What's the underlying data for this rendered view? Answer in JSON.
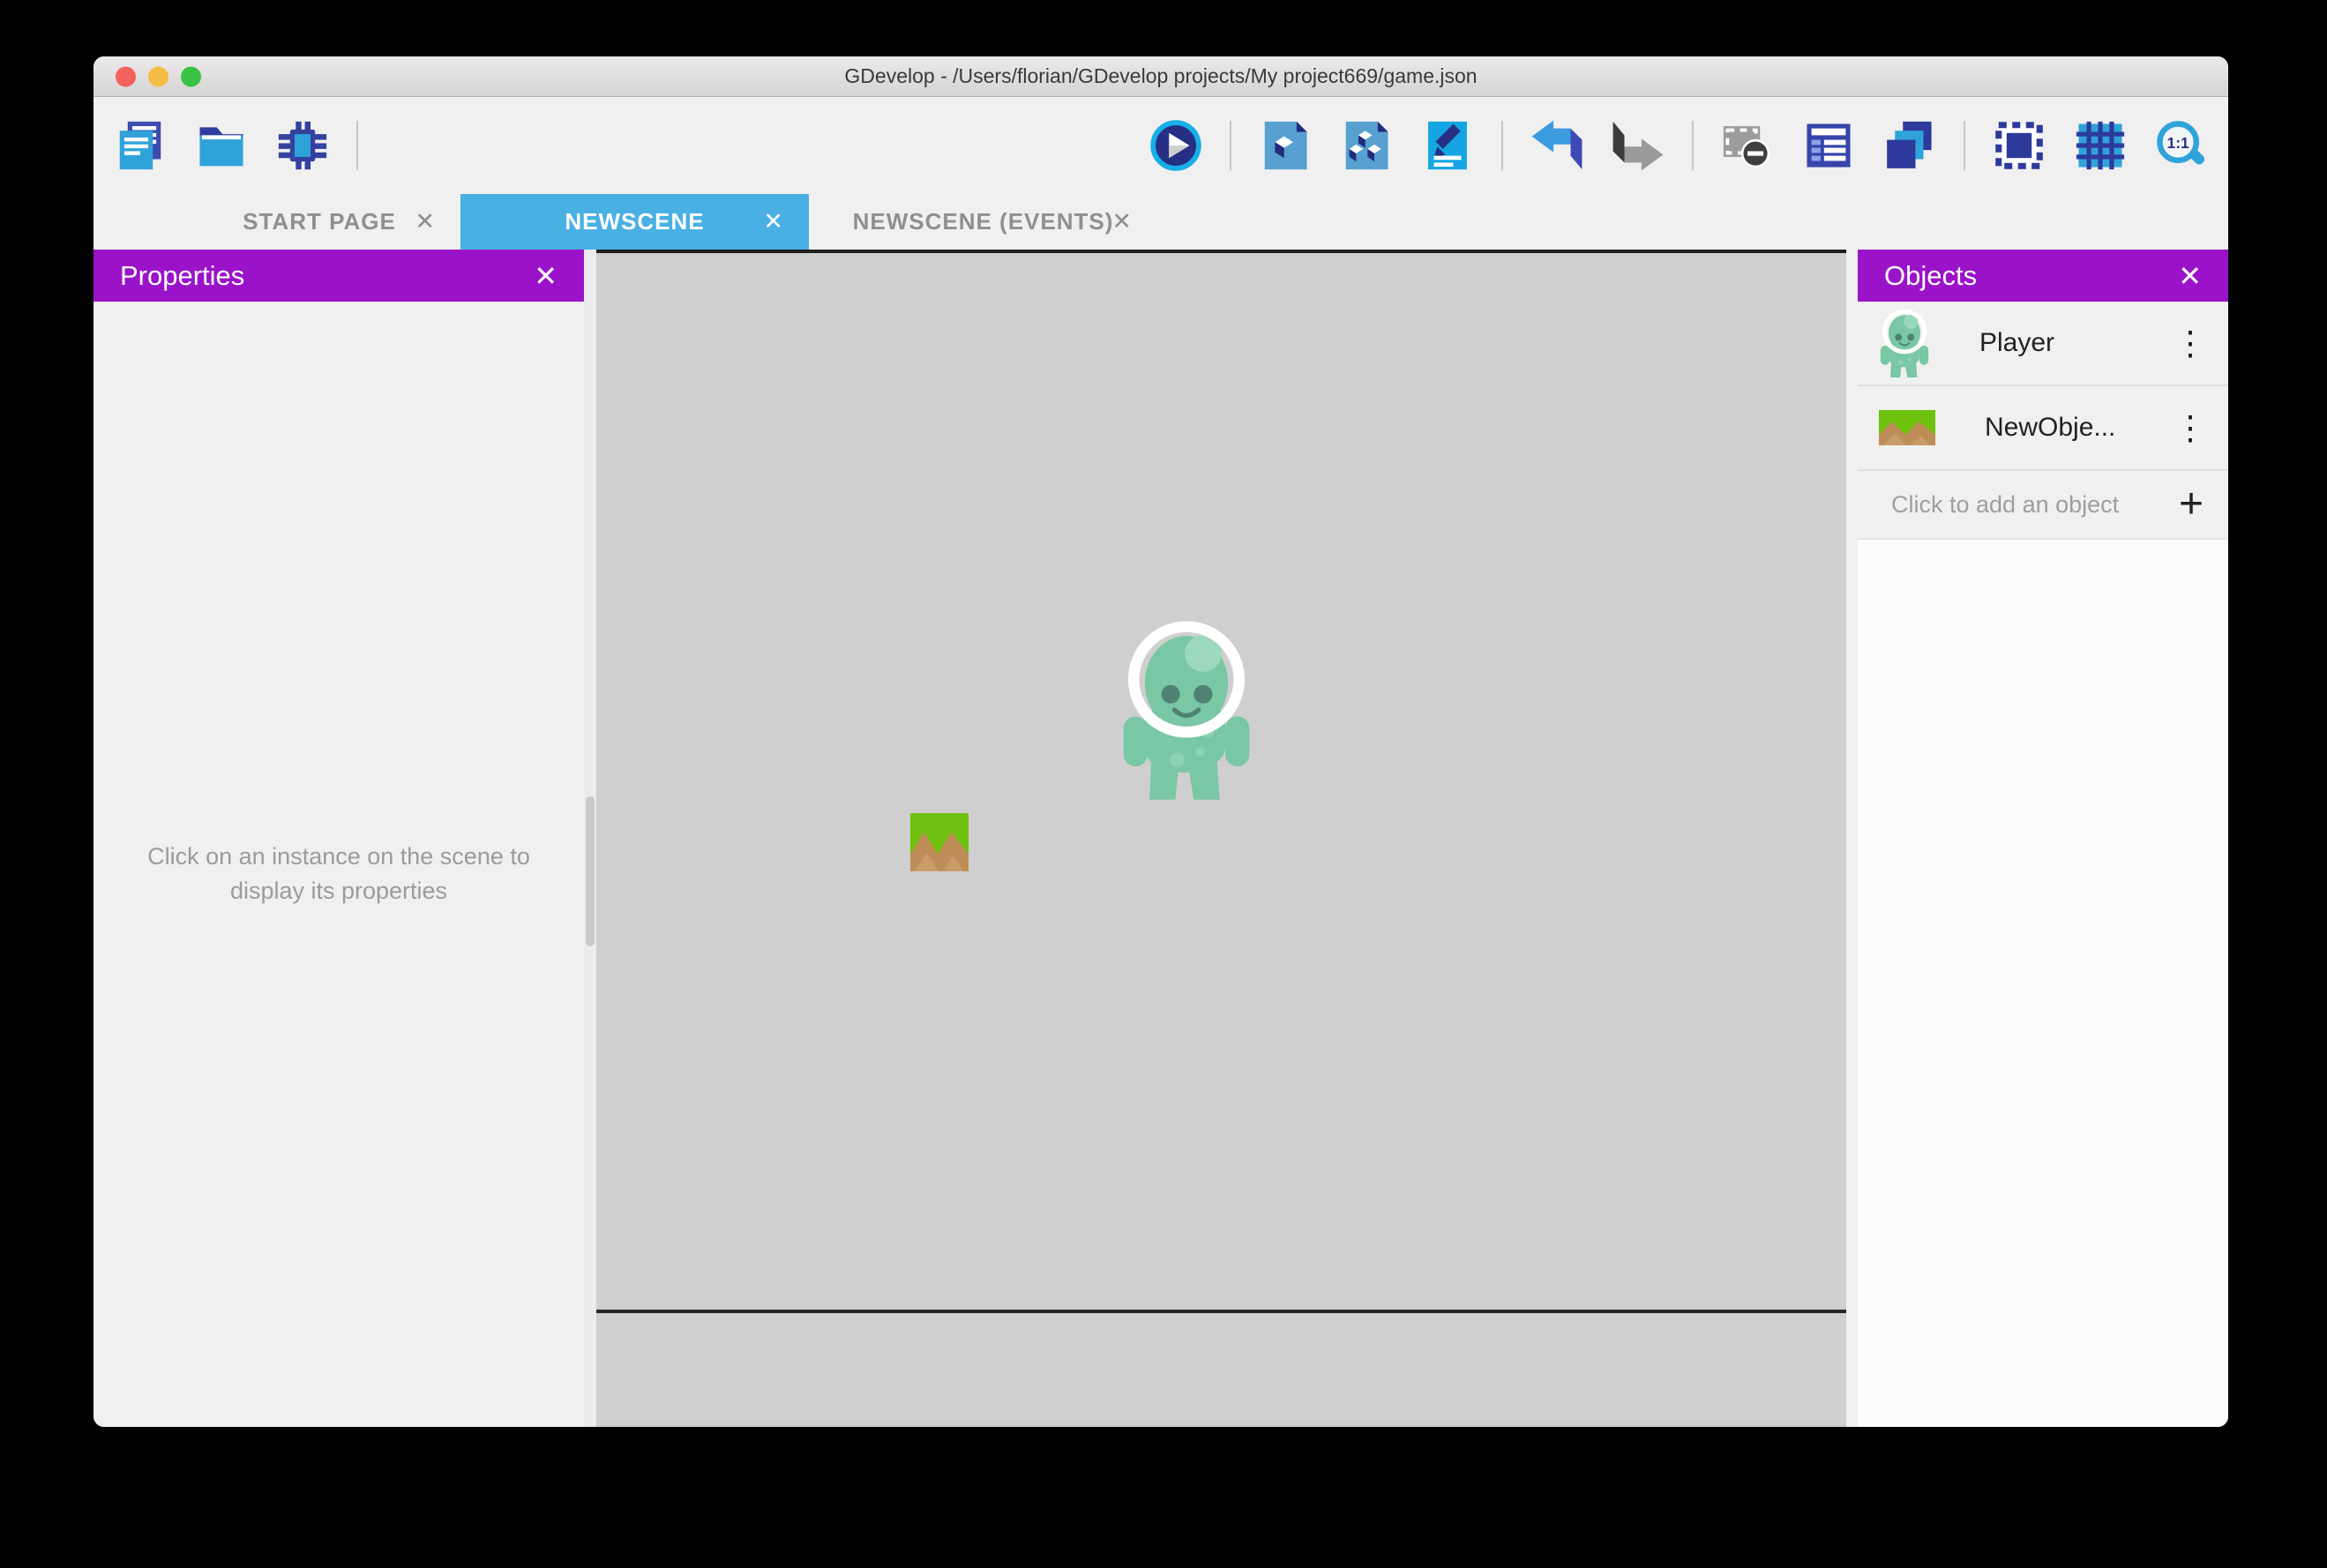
{
  "window": {
    "title": "GDevelop - /Users/florian/GDevelop projects/My project669/game.json",
    "traffic_lights": [
      "close",
      "minimize",
      "zoom"
    ]
  },
  "toolbar": {
    "left_icons": [
      "new-project-icon",
      "open-project-icon",
      "debugger-icon"
    ],
    "right_icons": [
      "preview-play-icon",
      "objects-editor-icon",
      "object-groups-icon",
      "scene-properties-icon",
      "undo-icon",
      "redo-icon",
      "delete-instances-icon",
      "instances-list-icon",
      "layers-editor-icon",
      "window-mask-icon",
      "grid-icon",
      "zoom-1-1-icon"
    ],
    "zoom_label": "1:1"
  },
  "tabs": [
    {
      "label": "START PAGE",
      "close": "✕",
      "active": false
    },
    {
      "label": "NEWSCENE",
      "close": "✕",
      "active": true
    },
    {
      "label": "NEWSCENE (EVENTS)",
      "close": "✕",
      "active": false
    }
  ],
  "properties_panel": {
    "title": "Properties",
    "close": "✕",
    "empty_hint": "Click on an instance on the scene to display its properties"
  },
  "objects_panel": {
    "title": "Objects",
    "close": "✕",
    "items": [
      {
        "label": "Player",
        "icon": "player-sprite",
        "menu": "⋮"
      },
      {
        "label": "NewObje...",
        "icon": "grass-platform",
        "menu": "⋮"
      }
    ],
    "add_hint": "Click to add an object",
    "add_icon": "+"
  },
  "scene": {
    "instances": [
      {
        "icon": "player-sprite"
      },
      {
        "icon": "grass-platform"
      }
    ]
  },
  "colors": {
    "accent_purple": "#9b13c9",
    "active_tab_blue": "#49b0e4",
    "canvas_gray": "#cfcfcf",
    "icon_navy": "#2d3a9b",
    "icon_blue": "#2fa3d9",
    "alien_teal": "#79c7a4",
    "grass_green": "#6ec10e",
    "dirt_brown": "#bf8d58"
  }
}
